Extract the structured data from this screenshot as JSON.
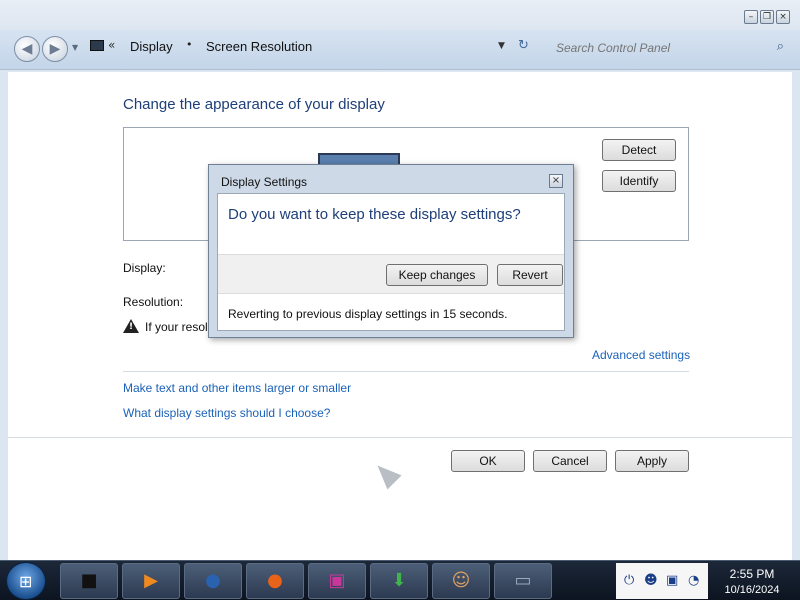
{
  "window": {
    "controls": [
      "minimize",
      "restore",
      "close"
    ]
  },
  "navbar": {
    "breadcrumb_sep": "«",
    "crumbs": [
      "Display",
      "Screen Resolution"
    ],
    "crumb_arrow": "•",
    "search_placeholder": "Search Control Panel",
    "icons": [
      "back-icon",
      "forward-icon",
      "control-panel-icon",
      "refresh-icon",
      "search-icon"
    ]
  },
  "main": {
    "title": "Change the appearance of your display",
    "detect_label": "Detect",
    "identify_label": "Identify",
    "display_label": "Display:",
    "resolution_label": "Resolution:",
    "warning_text": "If your resol",
    "advanced_link": "Advanced settings",
    "link_text_size": "Make text and other items larger or smaller",
    "link_what_settings": "What display settings should I choose?",
    "ok_label": "OK",
    "cancel_label": "Cancel",
    "apply_label": "Apply"
  },
  "dialog": {
    "title": "Display Settings",
    "question": "Do you want to keep these display settings?",
    "keep_label": "Keep changes",
    "revert_label": "Revert",
    "footer": "Reverting to previous display settings in 15 seconds."
  },
  "taskbar": {
    "apps": [
      "terminal-icon",
      "media-player-icon",
      "network-globe-icon",
      "firefox-icon",
      "image-viewer-icon",
      "download-icon",
      "user-icon",
      "monitor-icon"
    ],
    "tray_icons": [
      "usb-icon",
      "people-icon",
      "screen-icon",
      "wifi-icon"
    ],
    "time": "2:55 PM",
    "date": "10/16/2024"
  },
  "colors": {
    "heading": "#1e3f78",
    "link": "#1a62b8",
    "navbar": "#c4d5e9",
    "taskbar": "#0c1420"
  }
}
